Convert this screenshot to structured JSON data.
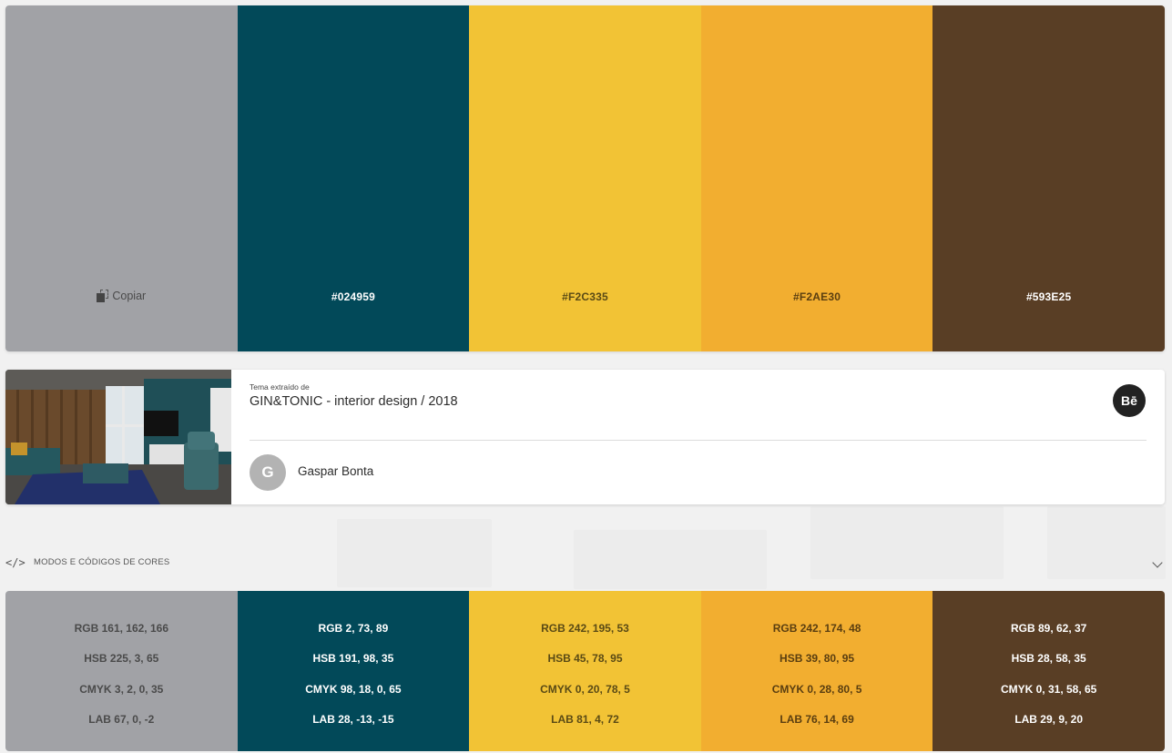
{
  "palette": {
    "copy_label": "Copiar",
    "swatches": [
      {
        "hex": "",
        "color": "#A1A2A6",
        "text_color": "#4a4a4a"
      },
      {
        "hex": "#024959",
        "color": "#024959",
        "text_color": "#ffffff"
      },
      {
        "hex": "#F2C335",
        "color": "#F2C335",
        "text_color": "#5a4a15"
      },
      {
        "hex": "#F2AE30",
        "color": "#F2AE30",
        "text_color": "#5a3e10"
      },
      {
        "hex": "#593E25",
        "color": "#593E25",
        "text_color": "#ffffff"
      }
    ]
  },
  "theme": {
    "extracted_label": "Tema extraído de",
    "title": "GIN&TONIC - interior design / 2018",
    "behance_icon": "Bē",
    "author_initial": "G",
    "author_name": "Gaspar Bonta"
  },
  "codes": {
    "header_icon": "</>",
    "header_title": "MODOS E CÓDIGOS DE CORES",
    "columns": [
      {
        "rgb": "RGB 161, 162, 166",
        "hsb": "HSB 225, 3, 65",
        "cmyk": "CMYK 3, 2, 0, 35",
        "lab": "LAB 67, 0, -2",
        "color": "#A1A2A6",
        "text_color": "#4a4a4a"
      },
      {
        "rgb": "RGB 2, 73, 89",
        "hsb": "HSB 191, 98, 35",
        "cmyk": "CMYK 98, 18, 0, 65",
        "lab": "LAB 28, -13, -15",
        "color": "#024959",
        "text_color": "#ffffff"
      },
      {
        "rgb": "RGB 242, 195, 53",
        "hsb": "HSB 45, 78, 95",
        "cmyk": "CMYK 0, 20, 78, 5",
        "lab": "LAB 81, 4, 72",
        "color": "#F2C335",
        "text_color": "#5a4a15"
      },
      {
        "rgb": "RGB 242, 174, 48",
        "hsb": "HSB 39, 80, 95",
        "cmyk": "CMYK 0, 28, 80, 5",
        "lab": "LAB 76, 14, 69",
        "color": "#F2AE30",
        "text_color": "#5a3e10"
      },
      {
        "rgb": "RGB 89, 62, 37",
        "hsb": "HSB 28, 58, 35",
        "cmyk": "CMYK 0, 31, 58, 65",
        "lab": "LAB 29, 9, 20",
        "color": "#593E25",
        "text_color": "#ffffff"
      }
    ]
  }
}
